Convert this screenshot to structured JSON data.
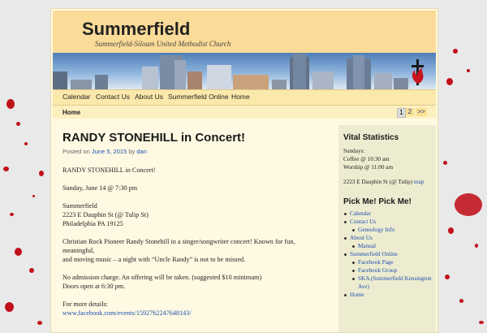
{
  "site": {
    "title": "Summerfield",
    "tagline": "Summerfield-Siloam United Methodist Church",
    "logo_icon": "methodist-cross-flame-icon"
  },
  "nav": {
    "items": [
      "Calendar",
      "Contact Us",
      "About Us",
      "Summerfield Online",
      "Home"
    ]
  },
  "breadcrumb": {
    "home": "Home"
  },
  "pagination": {
    "current": "1",
    "next_page": "2",
    "next": ">>"
  },
  "post": {
    "title": "RANDY STONEHILL in Concert!",
    "meta_prefix": "Posted on",
    "date": "June 5, 2015",
    "meta_by": "by",
    "author": "dan",
    "paragraphs": [
      [
        "RANDY STONEHILL in Concert!"
      ],
      [
        "Sunday, June 14 @ 7:30 pm"
      ],
      [
        "Summerfield",
        "2223 E Dauphin St (@ Tulip St)",
        "Philadelphia PA 19125"
      ],
      [
        "Christian Rock Pioneer Randy Stonehill in a singer/songwriter concert! Known for fun, meaningful,",
        "and moving music – a night with “Uncle Randy” is not to be missed."
      ],
      [
        "No admission charge. An offering will be taken. (suggested $10 minimum)",
        "Doors open at 6:30 pm."
      ],
      [
        "For more details:"
      ]
    ],
    "link": "www.facebook.com/events/1592762247648143/"
  },
  "sidebar": {
    "vital_title": "Vital Statistics",
    "vital_lines": [
      "Sundays:",
      "Coffee @ 10:30 am",
      "Worship @ 11:00 am"
    ],
    "address": "2223 E Dauphin St (@ Tulip)",
    "map_link": "map",
    "pick_title": "Pick Me! Pick Me!",
    "pick_items": [
      {
        "label": "Calendar",
        "level": 0
      },
      {
        "label": "Contact Us",
        "level": 0
      },
      {
        "label": "Geneology Info",
        "level": 1
      },
      {
        "label": "About Us",
        "level": 0
      },
      {
        "label": "Manual",
        "level": 1
      },
      {
        "label": "Summerfield Online",
        "level": 0
      },
      {
        "label": "Facebook Page",
        "level": 1
      },
      {
        "label": "Facebook Group",
        "level": 1
      },
      {
        "label": "SKA (Summerfield Kensington Ave)",
        "level": 1
      },
      {
        "label": "Home",
        "level": 0
      }
    ]
  },
  "colors": {
    "header_bg": "#fbdb98",
    "nav_bg": "#fbe9ab",
    "page_bg": "#fff9e3",
    "sidebar_bg": "#eeecd0",
    "link": "#1a4fb0",
    "splatter": "#c0101a"
  }
}
